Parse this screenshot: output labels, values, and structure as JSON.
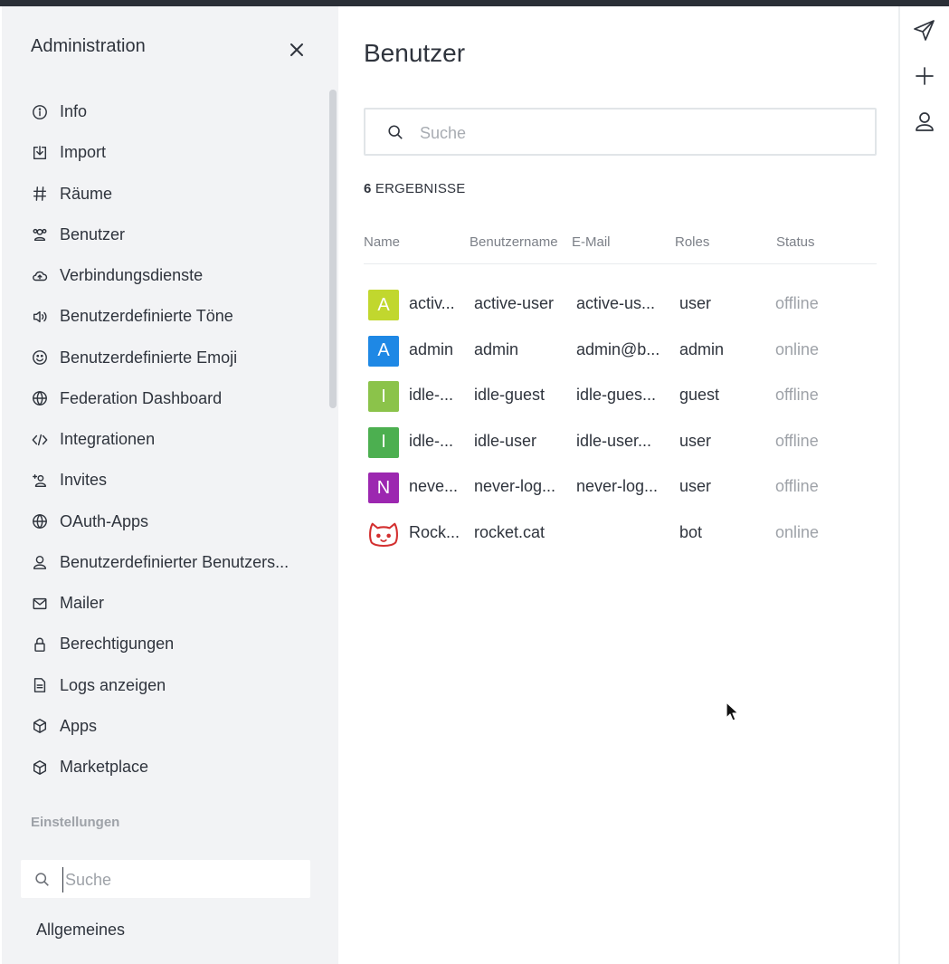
{
  "sidebar": {
    "title": "Administration",
    "items": [
      {
        "label": "Info",
        "icon": "info-icon"
      },
      {
        "label": "Import",
        "icon": "import-icon"
      },
      {
        "label": "Räume",
        "icon": "hash-icon"
      },
      {
        "label": "Benutzer",
        "icon": "users-icon"
      },
      {
        "label": "Verbindungsdienste",
        "icon": "cloud-icon"
      },
      {
        "label": "Benutzerdefinierte Töne",
        "icon": "sound-icon"
      },
      {
        "label": "Benutzerdefinierte Emoji",
        "icon": "emoji-icon"
      },
      {
        "label": "Federation Dashboard",
        "icon": "globe-icon"
      },
      {
        "label": "Integrationen",
        "icon": "code-icon"
      },
      {
        "label": "Invites",
        "icon": "user-plus-icon"
      },
      {
        "label": "OAuth-Apps",
        "icon": "globe-icon"
      },
      {
        "label": "Benutzerdefinierter Benutzers...",
        "icon": "user-icon"
      },
      {
        "label": "Mailer",
        "icon": "mail-icon"
      },
      {
        "label": "Berechtigungen",
        "icon": "lock-icon"
      },
      {
        "label": "Logs anzeigen",
        "icon": "document-icon"
      },
      {
        "label": "Apps",
        "icon": "cube-icon"
      },
      {
        "label": "Marketplace",
        "icon": "cube-icon"
      }
    ],
    "settings_heading": "Einstellungen",
    "settings_search_placeholder": "Suche",
    "general_label": "Allgemeines"
  },
  "main": {
    "title": "Benutzer",
    "search_placeholder": "Suche",
    "results_count": "6",
    "results_label": "ERGEBNISSE",
    "columns": {
      "name": "Name",
      "username": "Benutzername",
      "email": "E-Mail",
      "roles": "Roles",
      "status": "Status"
    },
    "rows": [
      {
        "initial": "A",
        "avatar_color": "#c1d72e",
        "name": "activ...",
        "username": "active-user",
        "email": "active-us...",
        "role": "user",
        "status": "offline"
      },
      {
        "initial": "A",
        "avatar_color": "#1e88e5",
        "name": "admin",
        "username": "admin",
        "email": "admin@b...",
        "role": "admin",
        "status": "online"
      },
      {
        "initial": "I",
        "avatar_color": "#8bc34a",
        "name": "idle-...",
        "username": "idle-guest",
        "email": "idle-gues...",
        "role": "guest",
        "status": "offline"
      },
      {
        "initial": "I",
        "avatar_color": "#4caf50",
        "name": "idle-...",
        "username": "idle-user",
        "email": "idle-user...",
        "role": "user",
        "status": "offline"
      },
      {
        "initial": "N",
        "avatar_color": "#9c27b0",
        "name": "neve...",
        "username": "never-log...",
        "email": "never-log...",
        "role": "user",
        "status": "offline"
      },
      {
        "initial": "",
        "avatar_icon": "rocket-cat-icon",
        "name": "Rock...",
        "username": "rocket.cat",
        "email": "",
        "role": "bot",
        "status": "online"
      }
    ]
  },
  "rail": {
    "buttons": [
      "send-icon",
      "plus-icon",
      "user-icon"
    ]
  }
}
